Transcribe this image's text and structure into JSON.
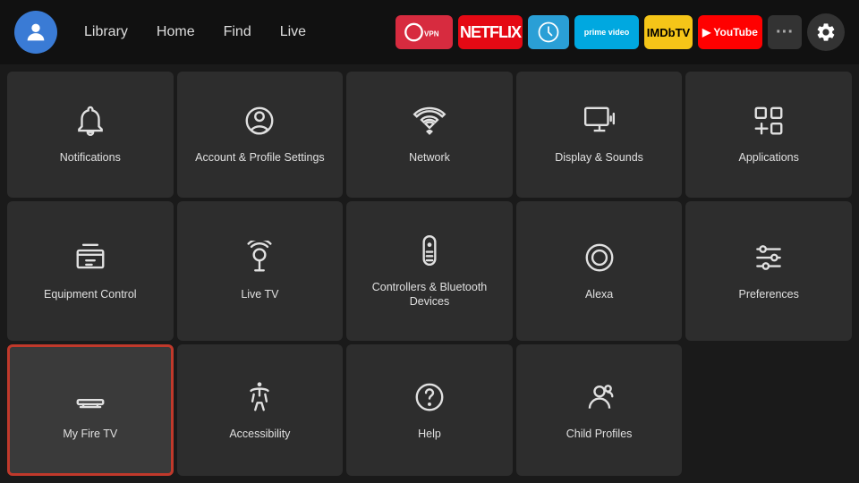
{
  "topnav": {
    "nav_items": [
      {
        "label": "Library",
        "id": "library"
      },
      {
        "label": "Home",
        "id": "home"
      },
      {
        "label": "Find",
        "id": "find"
      },
      {
        "label": "Live",
        "id": "live"
      }
    ],
    "apps": [
      {
        "id": "expressvpn",
        "label": "ExpressVPN"
      },
      {
        "id": "netflix",
        "label": "NETFLIX"
      },
      {
        "id": "freewheel",
        "label": ""
      },
      {
        "id": "prime",
        "label": "prime video"
      },
      {
        "id": "imdb",
        "label": "IMDbTV"
      },
      {
        "id": "youtube",
        "label": "▶ YouTube"
      },
      {
        "id": "more",
        "label": "···"
      }
    ],
    "gear_label": "Settings"
  },
  "grid": {
    "items": [
      {
        "id": "notifications",
        "label": "Notifications",
        "icon": "bell"
      },
      {
        "id": "account",
        "label": "Account & Profile Settings",
        "icon": "person-circle"
      },
      {
        "id": "network",
        "label": "Network",
        "icon": "wifi"
      },
      {
        "id": "display-sounds",
        "label": "Display & Sounds",
        "icon": "monitor-sound"
      },
      {
        "id": "applications",
        "label": "Applications",
        "icon": "apps"
      },
      {
        "id": "equipment",
        "label": "Equipment Control",
        "icon": "tv-remote"
      },
      {
        "id": "live-tv",
        "label": "Live TV",
        "icon": "antenna"
      },
      {
        "id": "controllers",
        "label": "Controllers & Bluetooth Devices",
        "icon": "remote"
      },
      {
        "id": "alexa",
        "label": "Alexa",
        "icon": "alexa"
      },
      {
        "id": "preferences",
        "label": "Preferences",
        "icon": "sliders"
      },
      {
        "id": "myfiretv",
        "label": "My Fire TV",
        "icon": "firetv",
        "selected": true
      },
      {
        "id": "accessibility",
        "label": "Accessibility",
        "icon": "accessibility"
      },
      {
        "id": "help",
        "label": "Help",
        "icon": "help"
      },
      {
        "id": "childprofiles",
        "label": "Child Profiles",
        "icon": "child-profile"
      }
    ]
  }
}
